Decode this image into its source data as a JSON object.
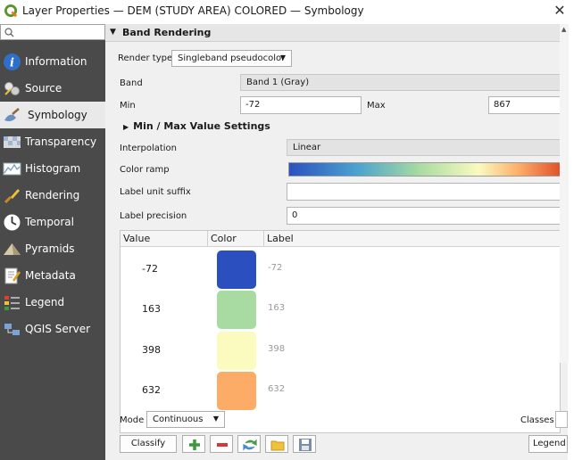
{
  "window": {
    "title": "Layer Properties — DEM (STUDY AREA) COLORED — Symbology",
    "close_glyph": "✕"
  },
  "sidebar": {
    "search_placeholder": "",
    "items": [
      {
        "label": "Information",
        "icon": "information-icon"
      },
      {
        "label": "Source",
        "icon": "source-icon"
      },
      {
        "label": "Symbology",
        "icon": "symbology-icon",
        "active": true
      },
      {
        "label": "Transparency",
        "icon": "transparency-icon"
      },
      {
        "label": "Histogram",
        "icon": "histogram-icon"
      },
      {
        "label": "Rendering",
        "icon": "rendering-icon"
      },
      {
        "label": "Temporal",
        "icon": "temporal-icon"
      },
      {
        "label": "Pyramids",
        "icon": "pyramids-icon"
      },
      {
        "label": "Metadata",
        "icon": "metadata-icon"
      },
      {
        "label": "Legend",
        "icon": "legend-icon"
      },
      {
        "label": "QGIS Server",
        "icon": "qgis-server-icon"
      }
    ]
  },
  "band_rendering": {
    "header": "Band Rendering",
    "render_type_label": "Render type",
    "render_type_value": "Singleband pseudocolor",
    "band_label": "Band",
    "band_value": "Band 1 (Gray)",
    "min_label": "Min",
    "min_value": "-72",
    "max_label": "Max",
    "max_value": "867",
    "minmax_settings": "Min / Max Value Settings",
    "interpolation_label": "Interpolation",
    "interpolation_value": "Linear",
    "color_ramp_label": "Color ramp",
    "label_unit_suffix_label": "Label unit suffix",
    "label_unit_suffix_value": "",
    "label_precision_label": "Label precision",
    "label_precision_value": "0"
  },
  "table": {
    "columns": [
      "Value",
      "Color",
      "Label"
    ],
    "rows": [
      {
        "value": "-72",
        "color": "#2b4fbf",
        "label": "-72"
      },
      {
        "value": "163",
        "color": "#a8dba2",
        "label": "163"
      },
      {
        "value": "398",
        "color": "#fbfbc0",
        "label": "398"
      },
      {
        "value": "632",
        "color": "#fdac67",
        "label": "632"
      }
    ]
  },
  "footer": {
    "mode_label": "Mode",
    "mode_value": "Continuous",
    "classes_label": "Classes",
    "classify_label": "Classify",
    "legend_label": "Legend"
  },
  "colors": {
    "sidebar_bg": "#4a4a4a",
    "panel_bg": "#f0f0f0",
    "add_green": "#3a9a3a",
    "remove_red": "#d23a3a"
  }
}
